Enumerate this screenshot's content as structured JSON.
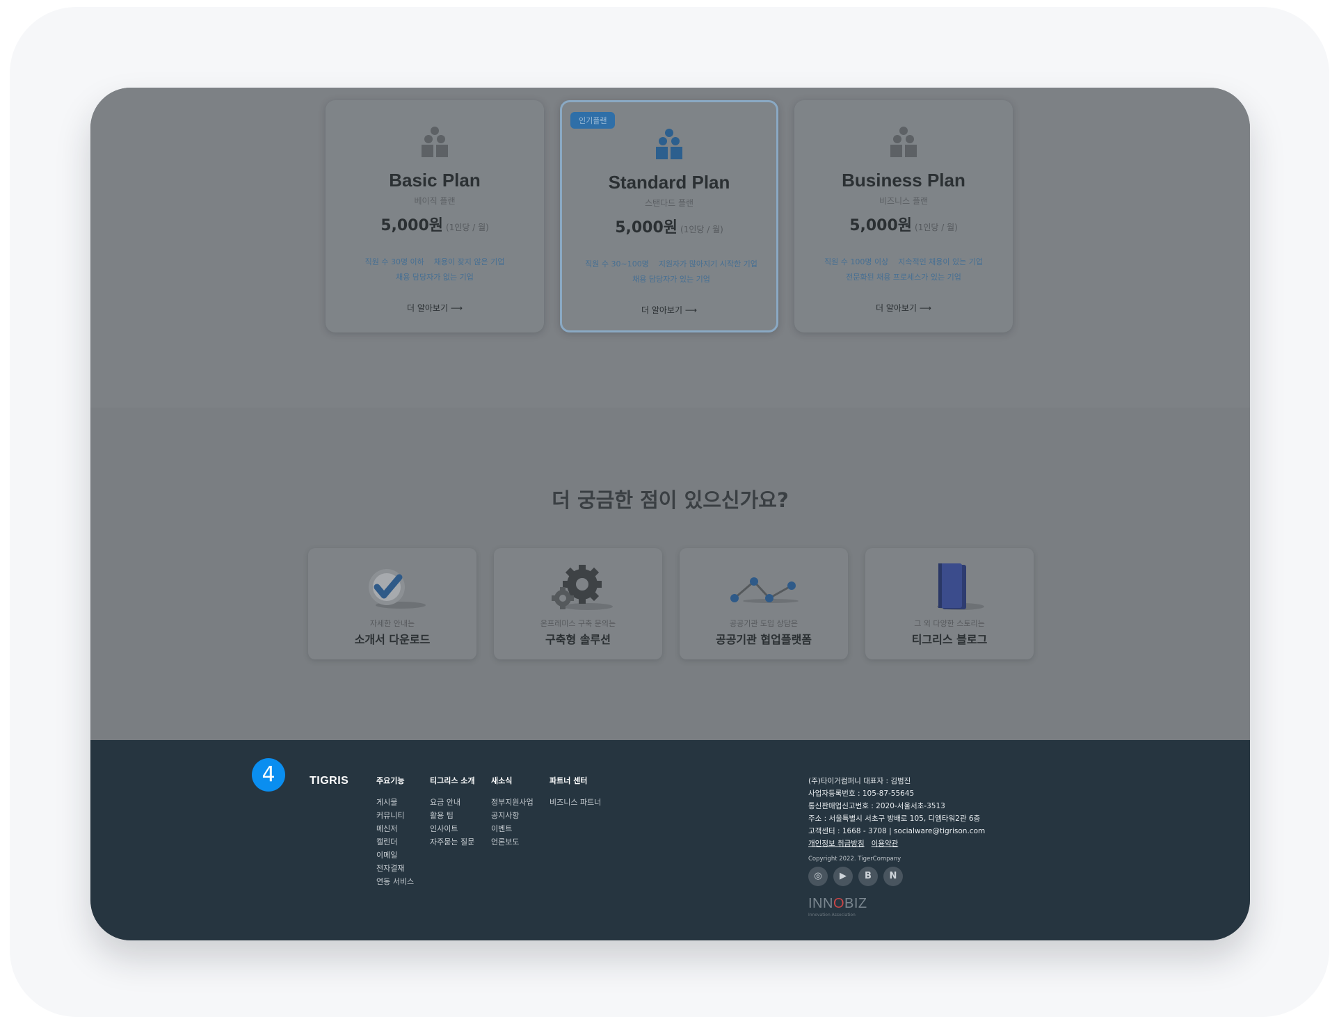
{
  "plans": [
    {
      "name": "Basic Plan",
      "sub": "베이직 플랜",
      "price": "5,000원",
      "unit": "(1인당 / 월)",
      "tags": [
        "직원 수 30명 이하",
        "채용이 잦지 않은 기업",
        "채용 담당자가 없는 기업"
      ],
      "more": "더 알아보기",
      "featured": false
    },
    {
      "badge": "인기플랜",
      "name": "Standard Plan",
      "sub": "스탠다드 플랜",
      "price": "5,000원",
      "unit": "(1인당 / 월)",
      "tags": [
        "직원 수 30~100명",
        "지원자가 많아지기 시작한 기업",
        "채용 담당자가 있는 기업"
      ],
      "more": "더 알아보기",
      "featured": true
    },
    {
      "name": "Business Plan",
      "sub": "비즈니스 플랜",
      "price": "5,000원",
      "unit": "(1인당 / 월)",
      "tags": [
        "직원 수 100명 이상",
        "지속적인 채용이 있는 기업",
        "전문화된 채용 프로세스가 있는 기업"
      ],
      "more": "더 알아보기",
      "featured": false
    }
  ],
  "faq": {
    "title": "더 궁금한 점이 있으신가요?",
    "cards": [
      {
        "sub": "자세한 안내는",
        "title": "소개서 다운로드",
        "icon": "check-icon"
      },
      {
        "sub": "온프레미스 구축 문의는",
        "title": "구축형 솔루션",
        "icon": "gear-icon"
      },
      {
        "sub": "공공기관 도입 상담은",
        "title": "공공기관 협업플랫폼",
        "icon": "network-icon"
      },
      {
        "sub": "그 외 다양한 스토리는",
        "title": "티그리스 블로그",
        "icon": "book-icon"
      }
    ]
  },
  "footer": {
    "step": "4",
    "logo": "TIGRIS",
    "columns": [
      {
        "heading": "주요기능",
        "items": [
          "게시물",
          "커뮤니티",
          "메신저",
          "캘린더",
          "이메일",
          "전자결재",
          "연동 서비스"
        ]
      },
      {
        "heading": "티그리스 소개",
        "items": [
          "요금 안내",
          "활용 팁",
          "인사이트",
          "자주묻는 질문"
        ]
      },
      {
        "heading": "새소식",
        "items": [
          "정부지원사업",
          "공지사항",
          "이벤트",
          "언론보도"
        ]
      },
      {
        "heading": "파트너 센터",
        "items": [
          "비즈니스 파트너"
        ]
      }
    ],
    "company": [
      "(주)타이거컴퍼니 대표자 : 김범진",
      "사업자등록번호 : 105-87-55645",
      "통신판매업신고번호 : 2020-서울서초-3513",
      "주소 : 서울특별시 서초구 방배로 105, 디엠타워2관 6층",
      "고객센터 : 1668 - 3708 | socialware@tigrison.com"
    ],
    "links": [
      "개인정보 취급방침",
      "이용약관"
    ],
    "copyright": "Copyright 2022. TigerCompany",
    "socials": [
      {
        "icon": "instagram-icon",
        "glyph": "◎"
      },
      {
        "icon": "youtube-icon",
        "glyph": "▶"
      },
      {
        "icon": "blog-icon",
        "glyph": "B"
      },
      {
        "icon": "naver-icon",
        "glyph": "N"
      }
    ],
    "innobiz": {
      "pre": "INN",
      "o": "O",
      "post": "BIZ",
      "sub": "Innovation Association"
    }
  },
  "colors": {
    "accent": "#0a8ef0",
    "footer_bg": "#263540",
    "featured_border": "#8aa9c4"
  }
}
